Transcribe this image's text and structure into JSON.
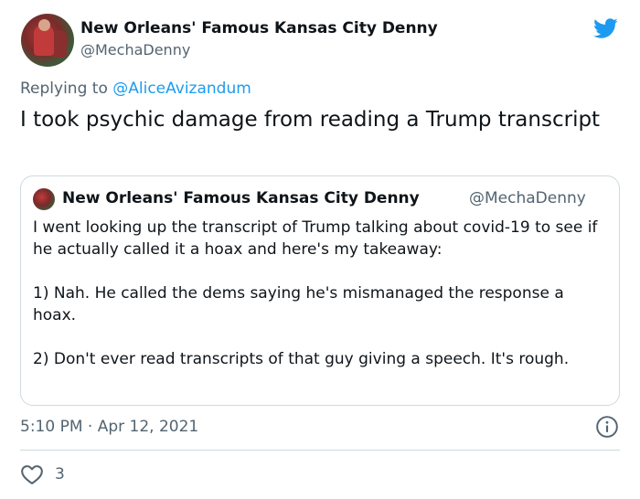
{
  "colors": {
    "accent": "#1d9bf0",
    "secondary_text": "#536471",
    "primary_text": "#0f1419",
    "border": "#cfd9de"
  },
  "author": {
    "display_name": "New Orleans' Famous Kansas City Denny",
    "handle": "@MechaDenny",
    "avatar_icon": "avatar-photo"
  },
  "platform_icon": "twitter-bird-icon",
  "reply": {
    "prefix": "Replying to",
    "mention": "@AliceAvizandum"
  },
  "tweet": {
    "text": "I took psychic damage from reading a Trump transcript"
  },
  "quote": {
    "display_name": "New Orleans' Famous Kansas City Denny",
    "handle": "@MechaDenny",
    "paragraphs": [
      "I went looking up the transcript of Trump talking about covid-19 to see if he actually called it a hoax and here's my takeaway:",
      "1) Nah. He called the dems saying he's mismanaged the response a hoax.",
      "2) Don't ever read transcripts of that guy giving a speech. It's rough."
    ]
  },
  "meta": {
    "timestamp": "5:10 PM · Apr 12, 2021",
    "info_icon": "info-icon"
  },
  "engagement": {
    "like_icon": "heart-icon",
    "likes": "3"
  }
}
